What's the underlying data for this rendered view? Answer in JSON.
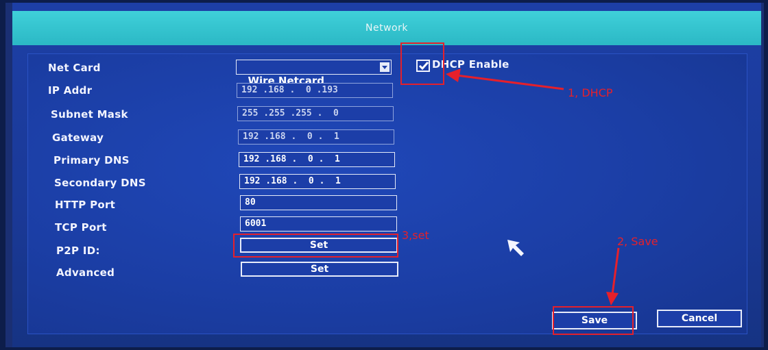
{
  "window": {
    "title": "Network"
  },
  "labels": {
    "net_card": "Net Card",
    "ip_addr": "IP Addr",
    "subnet_mask": "Subnet Mask",
    "gateway": "Gateway",
    "primary_dns": "Primary DNS",
    "secondary_dns": "Secondary DNS",
    "http_port": "HTTP Port",
    "tcp_port": "TCP Port",
    "p2p_id": "P2P ID:",
    "advanced": "Advanced"
  },
  "values": {
    "net_card": "Wire Netcard",
    "ip_addr": "192 .168 .  0 .193",
    "subnet_mask": "255 .255 .255 .  0",
    "gateway": "192 .168 .  0 .  1",
    "primary_dns": "192 .168 .  0 .  1",
    "secondary_dns": "192 .168 .  0 .  1",
    "http_port": "80",
    "tcp_port": "6001"
  },
  "dhcp": {
    "label": "DHCP Enable",
    "checked": true
  },
  "buttons": {
    "p2p_set": "Set",
    "advanced_set": "Set",
    "save": "Save",
    "cancel": "Cancel"
  },
  "annotations": {
    "dhcp": "1, DHCP",
    "save": "2, Save",
    "set": "3,set"
  },
  "colors": {
    "titlebar": "#2bb8c5",
    "panel": "#1b3ea5",
    "annotation": "#e5202b"
  }
}
